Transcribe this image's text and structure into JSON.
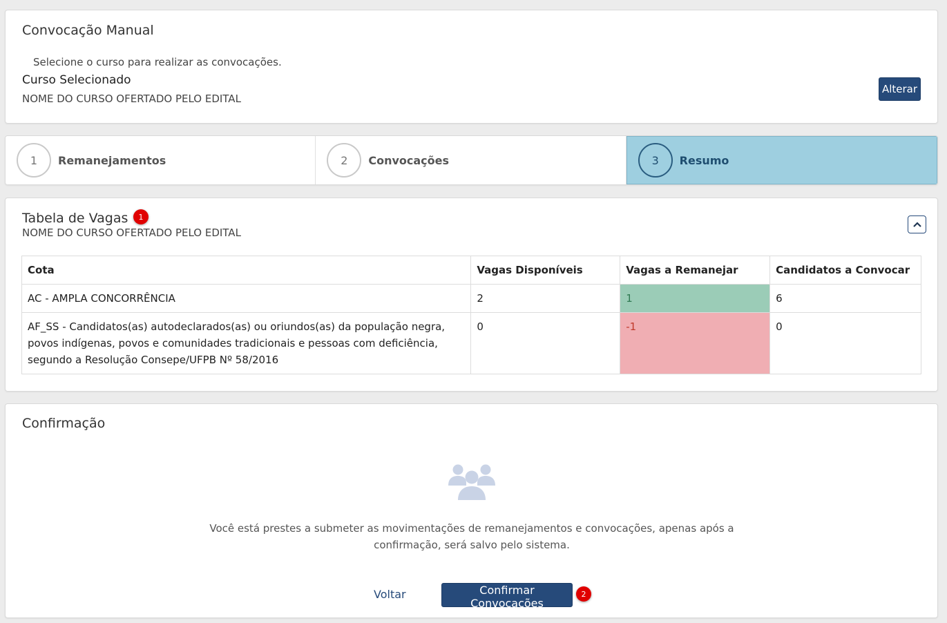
{
  "header": {
    "title": "Convocação Manual",
    "hint": "Selecione o curso para realizar as convocações.",
    "selected_label": "Curso Selecionado",
    "selected_value": "NOME DO CURSO OFERTADO PELO EDITAL",
    "alter_button": "Alterar"
  },
  "stepper": {
    "steps": [
      {
        "number": "1",
        "label": "Remanejamentos",
        "active": false
      },
      {
        "number": "2",
        "label": "Convocações",
        "active": false
      },
      {
        "number": "3",
        "label": "Resumo",
        "active": true
      }
    ]
  },
  "vagas_table": {
    "title": "Tabela de Vagas",
    "badge": "1",
    "subtitle": "NOME DO CURSO OFERTADO PELO EDITAL",
    "collapse_icon": "chevron-up-icon",
    "columns": [
      "Cota",
      "Vagas Disponíveis",
      "Vagas a Remanejar",
      "Candidatos a Convocar"
    ],
    "rows": [
      {
        "cota": "AC - AMPLA CONCORRÊNCIA",
        "disponiveis": "2",
        "remanejar": "1",
        "convocar": "6"
      },
      {
        "cota": "AF_SS - Candidatos(as) autodeclarados(as) ou oriundos(as) da população negra, povos indígenas, povos e comunidades tradicionais e pessoas com deficiência, segundo a Resolução Consepe/UFPB Nº 58/2016",
        "disponiveis": "0",
        "remanejar": "-1",
        "convocar": "0"
      }
    ]
  },
  "confirm": {
    "title": "Confirmação",
    "icon": "users-group-icon",
    "message": "Você está prestes a submeter as movimentações de remanejamentos e convocações, apenas após a confirmação, será salvo pelo sistema.",
    "back_label": "Voltar",
    "confirm_label": "Confirmar Convocações",
    "badge": "2"
  },
  "colors": {
    "primary": "#264a7a",
    "active_step_bg": "#9ecfe0",
    "positive_cell": "#9bccb7",
    "negative_cell": "#f0aeb3",
    "badge": "#e00000"
  }
}
